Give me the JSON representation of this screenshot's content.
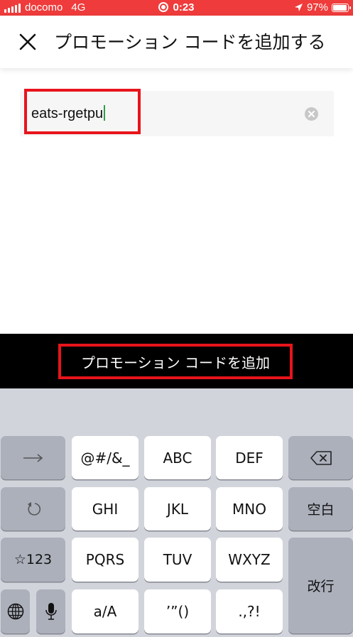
{
  "status_bar": {
    "carrier": "docomo",
    "network": "4G",
    "time": "0:23",
    "battery": "97%"
  },
  "nav": {
    "title": "プロモーション コードを追加する"
  },
  "promo_input": {
    "value": "eats-rgetpu"
  },
  "add_button": {
    "label": "プロモーション コードを追加"
  },
  "keyboard": {
    "keys": {
      "k12": "@#/&_",
      "k13": "ABC",
      "k14": "DEF",
      "k22": "GHI",
      "k23": "JKL",
      "k24": "MNO",
      "k25": "空白",
      "k31": "☆123",
      "k32": "PQRS",
      "k33": "TUV",
      "k34": "WXYZ",
      "k35": "改行",
      "k43": "a/A",
      "k44": "’”()",
      "k45": ".,?!"
    }
  },
  "colors": {
    "status_bar": "#ef3b3b",
    "highlight": "#e8141b",
    "cursor": "#2e9e48",
    "promo_bar": "#000000",
    "keyboard_bg": "#d2d4db"
  }
}
